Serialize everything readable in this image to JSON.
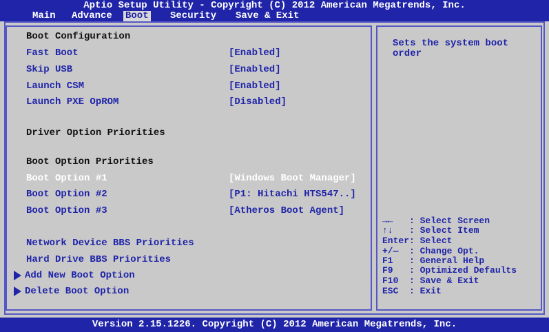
{
  "title": "Aptio Setup Utility - Copyright (C) 2012 American Megatrends, Inc.",
  "menu": [
    {
      "label": "Main"
    },
    {
      "label": "Advance"
    },
    {
      "label": "Boot"
    },
    {
      "label": "Security"
    },
    {
      "label": "Save & Exit"
    }
  ],
  "left": {
    "boot_config_header": "Boot Configuration",
    "fast_boot_label": "Fast Boot",
    "fast_boot_value": "[Enabled]",
    "skip_usb_label": "Skip USB",
    "skip_usb_value": "[Enabled]",
    "launch_csm_label": "Launch CSM",
    "launch_csm_value": "[Enabled]",
    "launch_pxe_label": "Launch PXE OpROM",
    "launch_pxe_value": "[Disabled]",
    "driver_priorities_header": "Driver Option Priorities",
    "boot_priorities_header": "Boot Option Priorities",
    "boot_option_1_label": "Boot Option #1",
    "boot_option_1_value": "[Windows Boot Manager]",
    "boot_option_2_label": "Boot Option #2",
    "boot_option_2_value": "[P1: Hitachi HTS547..]",
    "boot_option_3_label": "Boot Option #3",
    "boot_option_3_value": "[Atheros Boot Agent]",
    "network_bbs_label": "Network Device BBS Priorities",
    "hard_drive_bbs_label": "Hard Drive BBS Priorities",
    "add_boot_option_label": "Add New Boot Option",
    "delete_boot_option_label": "Delete Boot Option"
  },
  "help_text": "Sets the system boot order",
  "keys": {
    "select_screen": "→←   : Select Screen",
    "select_item": "↑↓   : Select Item",
    "enter": "Enter: Select",
    "change": "+/—  : Change Opt.",
    "f1": "F1   : General Help",
    "f9": "F9   : Optimized Defaults",
    "f10": "F10  : Save & Exit",
    "esc": "ESC  : Exit"
  },
  "footer": "Version 2.15.1226. Copyright (C) 2012 American Megatrends, Inc.",
  "colors": {
    "accent": "#1f24a8",
    "panel": "#c9c9c9",
    "border": "#5557c4"
  }
}
